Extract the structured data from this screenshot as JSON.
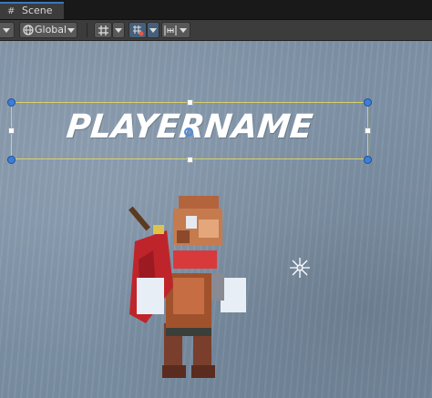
{
  "tab": {
    "label": "Scene",
    "icon": "hash-icon"
  },
  "toolbar": {
    "pivot_mode": "Global",
    "icons": [
      "dropdown-arrow-icon",
      "globe-icon",
      "grid-snap-icon",
      "grid-visibility-icon",
      "increment-snap-icon"
    ]
  },
  "scene": {
    "player_name_text": "PLAYERNAME",
    "background_color": "#8296aa",
    "selection_color": "#d8d06a",
    "handle_color": "#3d7fd8"
  }
}
